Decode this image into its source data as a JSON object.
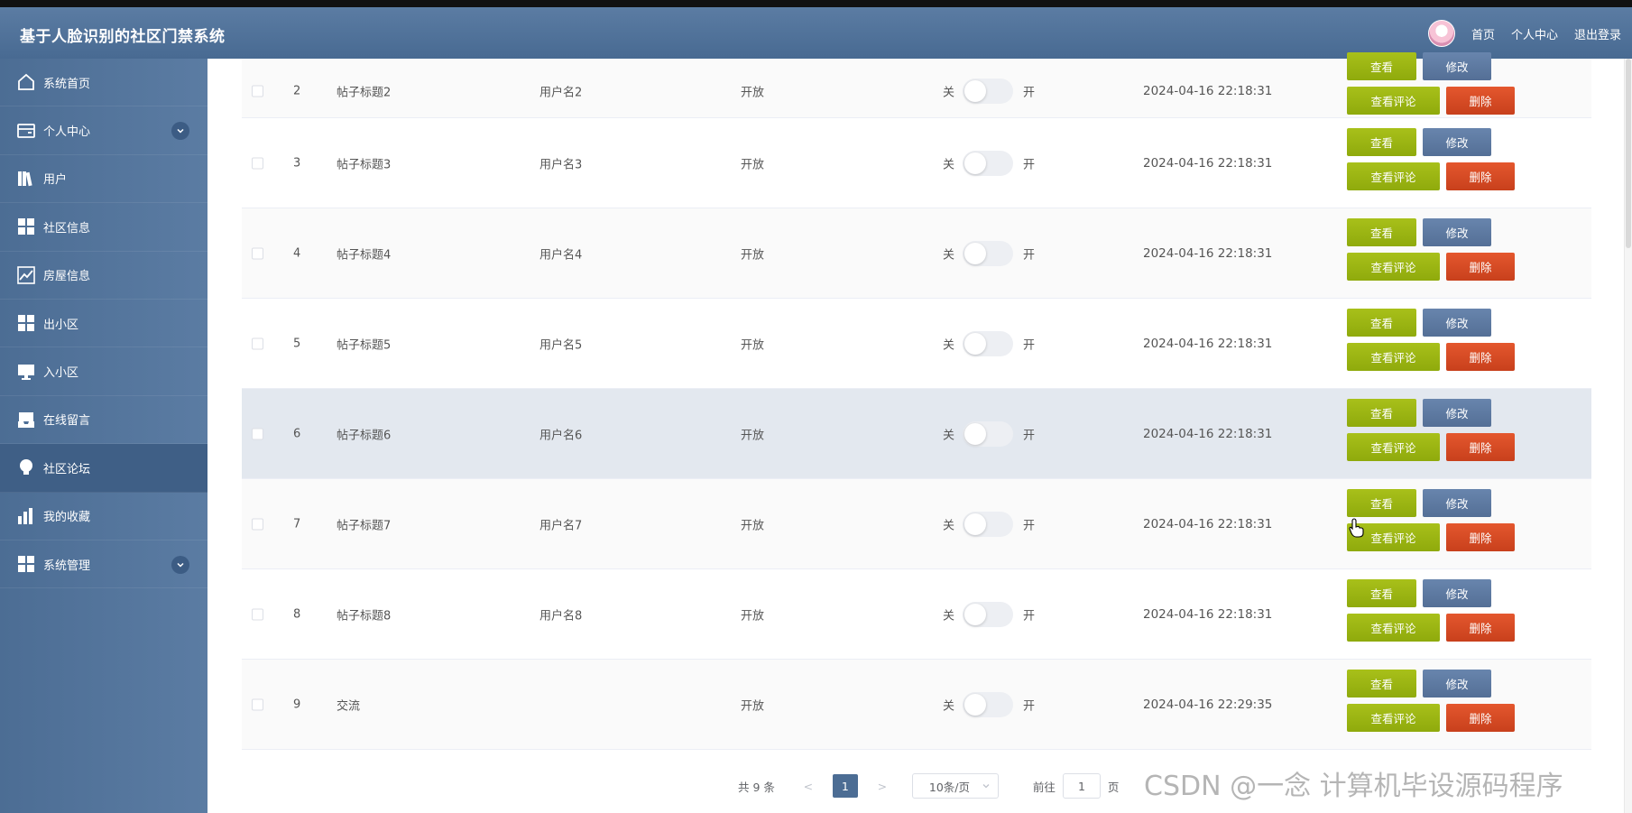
{
  "header": {
    "app_title": "基于人脸识别的社区门禁系统",
    "nav": [
      "首页",
      "个人中心",
      "退出登录"
    ]
  },
  "sidebar": {
    "items": [
      {
        "label": "系统首页",
        "icon": "home-icon"
      },
      {
        "label": "个人中心",
        "icon": "card-icon",
        "expandable": true
      },
      {
        "label": "用户",
        "icon": "books-icon"
      },
      {
        "label": "社区信息",
        "icon": "grid-icon"
      },
      {
        "label": "房屋信息",
        "icon": "trend-chart-icon"
      },
      {
        "label": "出小区",
        "icon": "grid-icon"
      },
      {
        "label": "入小区",
        "icon": "monitor-icon"
      },
      {
        "label": "在线留言",
        "icon": "inbox-icon"
      },
      {
        "label": "社区论坛",
        "icon": "bulb-icon",
        "active": true
      },
      {
        "label": "我的收藏",
        "icon": "bar-chart-icon"
      },
      {
        "label": "系统管理",
        "icon": "grid-icon",
        "expandable": true
      }
    ]
  },
  "table": {
    "rows": [
      {
        "id": "2",
        "title": "帖子标题2",
        "user": "用户名2",
        "status": "开放",
        "off": "关",
        "on": "开",
        "time": "2024-04-16 22:18:31"
      },
      {
        "id": "3",
        "title": "帖子标题3",
        "user": "用户名3",
        "status": "开放",
        "off": "关",
        "on": "开",
        "time": "2024-04-16 22:18:31"
      },
      {
        "id": "4",
        "title": "帖子标题4",
        "user": "用户名4",
        "status": "开放",
        "off": "关",
        "on": "开",
        "time": "2024-04-16 22:18:31"
      },
      {
        "id": "5",
        "title": "帖子标题5",
        "user": "用户名5",
        "status": "开放",
        "off": "关",
        "on": "开",
        "time": "2024-04-16 22:18:31"
      },
      {
        "id": "6",
        "title": "帖子标题6",
        "user": "用户名6",
        "status": "开放",
        "off": "关",
        "on": "开",
        "time": "2024-04-16 22:18:31"
      },
      {
        "id": "7",
        "title": "帖子标题7",
        "user": "用户名7",
        "status": "开放",
        "off": "关",
        "on": "开",
        "time": "2024-04-16 22:18:31"
      },
      {
        "id": "8",
        "title": "帖子标题8",
        "user": "用户名8",
        "status": "开放",
        "off": "关",
        "on": "开",
        "time": "2024-04-16 22:18:31"
      },
      {
        "id": "9",
        "title": "交流",
        "user": "",
        "status": "开放",
        "off": "关",
        "on": "开",
        "time": "2024-04-16 22:29:35"
      }
    ],
    "actions": {
      "view": "查看",
      "edit": "修改",
      "comments": "查看评论",
      "delete": "删除"
    }
  },
  "pagination": {
    "total": "共 9 条",
    "prev": "<",
    "current": "1",
    "next": ">",
    "page_size": "10条/页",
    "goto_prefix": "前往",
    "goto_value": "1",
    "goto_suffix": "页"
  },
  "watermark": "CSDN @一念 计算机毕设源码程序",
  "colors": {
    "header": "#5b7ca3",
    "sidebar": "#4c6d94",
    "btn_green": "#9ab512",
    "btn_blue": "#5f7ca4",
    "btn_red": "#d84b24"
  }
}
